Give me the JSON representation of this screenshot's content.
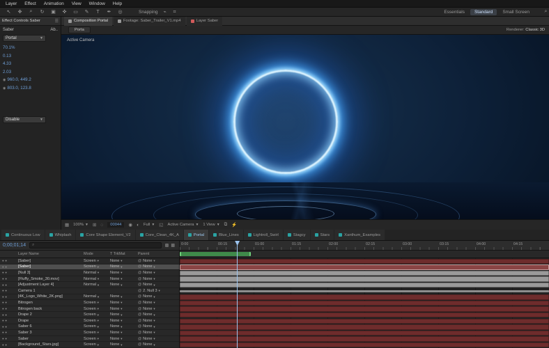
{
  "colors": {
    "accent_blue": "#6f9fd8",
    "bar_red": "#6e2c2c",
    "bar_gray": "#9a9a9a",
    "workarea_green": "#3f8a4a",
    "layer_tab_icon_red": "#d05a5a",
    "project_tab_icon_teal": "#2aa3a3"
  },
  "menu": {
    "items": [
      "Layer",
      "Effect",
      "Animation",
      "View",
      "Window",
      "Help"
    ]
  },
  "toolbar": {
    "tools": [
      {
        "name": "selection-tool",
        "glyph": "↖"
      },
      {
        "name": "hand-tool",
        "glyph": "✥"
      },
      {
        "name": "zoom-tool",
        "glyph": "⌕"
      },
      {
        "name": "rotation-tool",
        "glyph": "↻"
      },
      {
        "name": "camera-tool",
        "glyph": "▣"
      },
      {
        "name": "pan-behind-tool",
        "glyph": "✜"
      },
      {
        "name": "shape-tool",
        "glyph": "▭"
      },
      {
        "name": "pen-tool",
        "glyph": "✎"
      },
      {
        "name": "type-tool",
        "glyph": "T"
      },
      {
        "name": "brush-tool",
        "glyph": "✒"
      },
      {
        "name": "puppet-tool",
        "glyph": "◎"
      }
    ],
    "snapping_label": "Snapping",
    "snap_icons": "⌁ ⌗",
    "workspaces": [
      "Essentials",
      "Standard",
      "Small Screen"
    ],
    "active_workspace": "Standard"
  },
  "effect_controls": {
    "tab_label": "Effect Controls Saber",
    "title": "Saber",
    "about_label": "Ab..",
    "preset_value": "Portal",
    "values": [
      "70.1%",
      "0.13",
      "4.33",
      "2.03"
    ],
    "points": [
      "960.0, 449.2",
      "803.0, 123.8"
    ],
    "dropdown2_value": "Disable"
  },
  "composition": {
    "tabs": [
      {
        "label": "Composition Portal",
        "active": true,
        "icon_color": "#9a9a9a"
      },
      {
        "label": "Footage: Saber_Trailer_V1.mp4",
        "active": false,
        "icon_color": "#9a9a9a"
      },
      {
        "label": "Layer Saber",
        "active": false,
        "icon_color": "#d05a5a"
      }
    ],
    "sub_tab": "Porta",
    "renderer_label": "Renderer:",
    "renderer_value": "Classic 3D",
    "view_label": "Active Camera"
  },
  "viewport_footer": {
    "zoom": "100%",
    "timecode": "00044",
    "resolution": "Full",
    "camera": "Active Camera",
    "view_layout": "1 View",
    "icons": [
      {
        "name": "transparency-grid-icon",
        "glyph": "▦"
      },
      {
        "name": "choose-grid-icon",
        "glyph": "⊞"
      },
      {
        "name": "mask-visibility-icon",
        "glyph": "◌"
      },
      {
        "name": "snapshot-icon",
        "glyph": "◉"
      },
      {
        "name": "show-channel-icon",
        "glyph": "◐"
      },
      {
        "name": "roi-icon",
        "glyph": "◱"
      },
      {
        "name": "pixel-aspect-icon",
        "glyph": "⧉"
      },
      {
        "name": "fast-preview-icon",
        "glyph": "⚡"
      }
    ]
  },
  "project_tabs": [
    {
      "label": "Continuous Low",
      "active": false
    },
    {
      "label": "Whiplash",
      "active": false
    },
    {
      "label": "Core Shape Element_V2",
      "active": false
    },
    {
      "label": "Core_Clean_4K_A",
      "active": false
    },
    {
      "label": "Portal",
      "active": true
    },
    {
      "label": "Blue_Lines",
      "active": false
    },
    {
      "label": "Lightroll_Swirl",
      "active": false
    },
    {
      "label": "Stagcy",
      "active": false
    },
    {
      "label": "Stars",
      "active": false
    },
    {
      "label": "Xanthum_Examples",
      "active": false
    }
  ],
  "timeline": {
    "current_time": "0;00;01;14",
    "search_placeholder": "",
    "columns": {
      "layer_name": "Layer Name",
      "mode": "Mode",
      "trkmat": "T TrkMat",
      "parent": "Parent"
    },
    "ruler": [
      "0:00",
      "00:15",
      "01:00",
      "01:15",
      "02:00",
      "02:15",
      "03:00",
      "03:15",
      "04:00",
      "04:15"
    ],
    "work_area": {
      "start_frac": 0.0,
      "end_frac": 0.192
    },
    "playhead_frac": 0.155,
    "rows": [
      {
        "name": "[Saber]",
        "mode": "Screen",
        "trkmat": "None",
        "parent": "None",
        "bar": "red",
        "selected": false
      },
      {
        "name": "[Saber]",
        "mode": "Screen",
        "trkmat": "None",
        "parent": "None",
        "bar": "red",
        "selected": true
      },
      {
        "name": "[Null 3]",
        "mode": "Normal",
        "trkmat": "None",
        "parent": "None",
        "bar": "gray",
        "selected": false
      },
      {
        "name": "[Fluffy_Smoke_30.mov]",
        "mode": "Normal",
        "trkmat": "None",
        "parent": "None",
        "bar": "gray",
        "selected": false
      },
      {
        "name": "[Adjustment Layer 4]",
        "mode": "Normal",
        "trkmat": "None",
        "parent": "None",
        "bar": "gray",
        "selected": false
      },
      {
        "name": "Camera 1",
        "mode": "",
        "trkmat": "",
        "parent": "2. Null 3",
        "bar": "thin",
        "selected": false
      },
      {
        "name": "[4K_Logo_White_2K.png]",
        "mode": "Normal",
        "trkmat": "None",
        "parent": "None",
        "bar": "red",
        "selected": false
      },
      {
        "name": "Bitrogen",
        "mode": "Screen",
        "trkmat": "None",
        "parent": "None",
        "bar": "red",
        "selected": false
      },
      {
        "name": "Bitrogen back",
        "mode": "Screen",
        "trkmat": "None",
        "parent": "None",
        "bar": "red",
        "selected": false
      },
      {
        "name": "Drape 2",
        "mode": "Screen",
        "trkmat": "None",
        "parent": "None",
        "bar": "red",
        "selected": false
      },
      {
        "name": "Drape",
        "mode": "Screen",
        "trkmat": "None",
        "parent": "None",
        "bar": "red",
        "selected": false
      },
      {
        "name": "Saber 6",
        "mode": "Screen",
        "trkmat": "None",
        "parent": "None",
        "bar": "red",
        "selected": false
      },
      {
        "name": "Saber 3",
        "mode": "Screen",
        "trkmat": "None",
        "parent": "None",
        "bar": "red",
        "selected": false
      },
      {
        "name": "Saber",
        "mode": "Screen",
        "trkmat": "None",
        "parent": "None",
        "bar": "red",
        "selected": false
      },
      {
        "name": "[Background_Stars.jpg]",
        "mode": "Screen",
        "trkmat": "None",
        "parent": "None",
        "bar": "red",
        "selected": false
      }
    ]
  }
}
